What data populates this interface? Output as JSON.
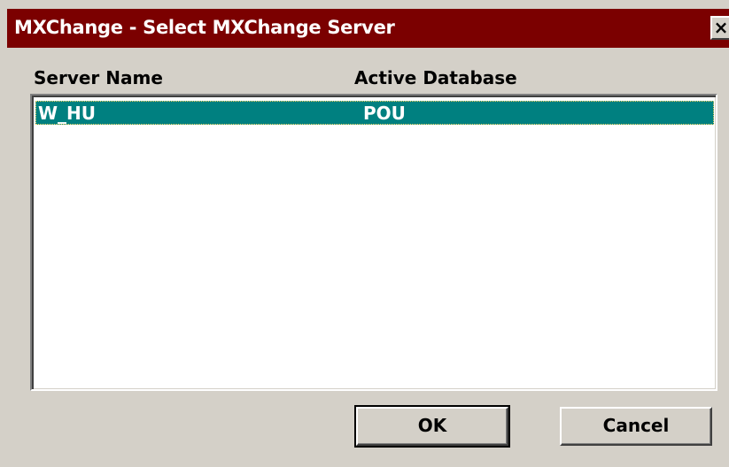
{
  "window": {
    "title": "MXChange - Select MXChange Server",
    "close_label": "×"
  },
  "columns": {
    "server_name": "Server Name",
    "active_database": "Active Database"
  },
  "rows": [
    {
      "server_name": "W_HU",
      "active_database": "POU",
      "selected": true
    }
  ],
  "buttons": {
    "ok": "OK",
    "cancel": "Cancel"
  },
  "colors": {
    "titlebar": "#7b0000",
    "selection": "#008080",
    "face": "#d4d0c8"
  }
}
